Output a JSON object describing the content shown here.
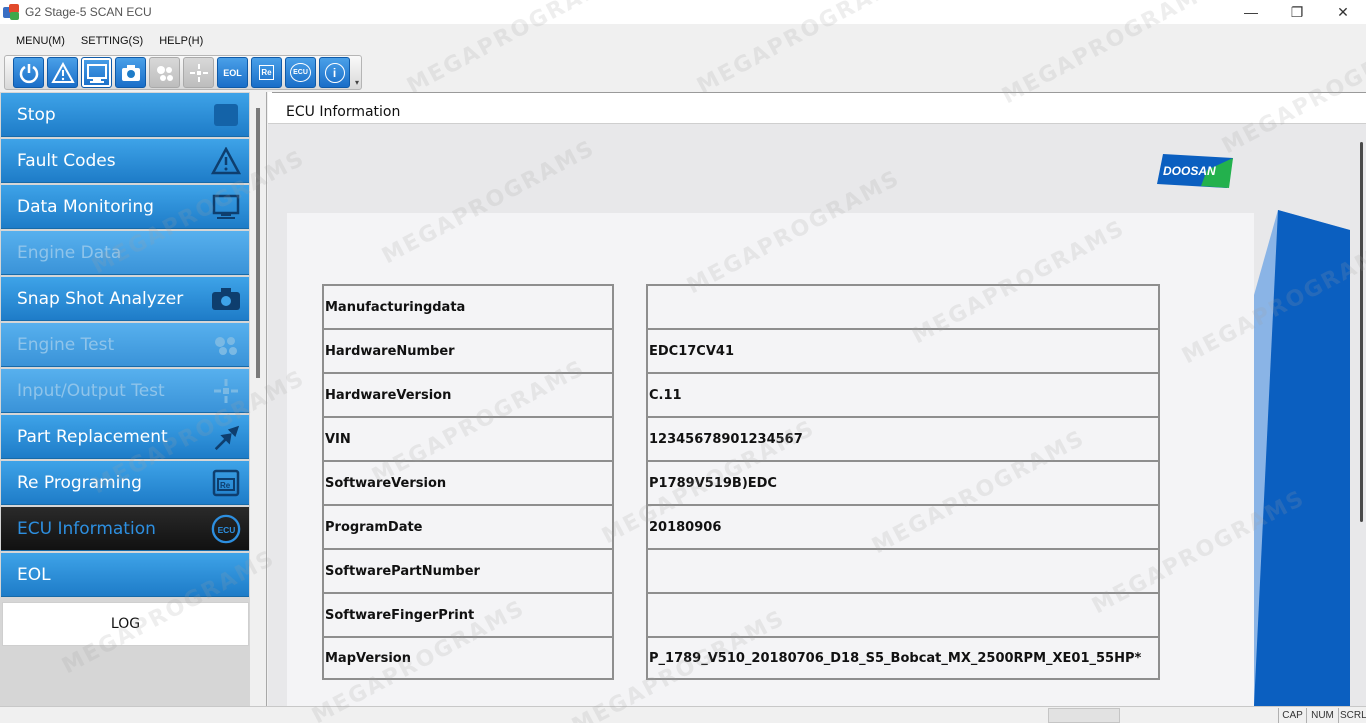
{
  "window": {
    "title": "G2 Stage-5 SCAN ECU",
    "controls": {
      "minimize": "—",
      "maximize": "❐",
      "close": "✕"
    }
  },
  "menu": [
    "MENU(M)",
    "SETTING(S)",
    "HELP(H)"
  ],
  "toolbar": {
    "buttons": [
      {
        "icon": "power-icon",
        "state": "enabled"
      },
      {
        "icon": "warning-icon",
        "state": "enabled"
      },
      {
        "icon": "monitor-icon",
        "state": "active"
      },
      {
        "icon": "camera-icon",
        "state": "enabled"
      },
      {
        "icon": "engine-icon",
        "state": "disabled"
      },
      {
        "icon": "io-icon",
        "state": "disabled"
      },
      {
        "icon": "eol-icon",
        "state": "enabled",
        "text": "EOL"
      },
      {
        "icon": "reprogram-icon",
        "state": "enabled",
        "text": "Re"
      },
      {
        "icon": "ecu-icon",
        "state": "enabled",
        "text": "ECU"
      },
      {
        "icon": "info-icon",
        "state": "enabled",
        "text": "i"
      }
    ]
  },
  "sidebar": {
    "items": [
      {
        "label": "Stop",
        "state": "enabled",
        "icon": "stop-icon"
      },
      {
        "label": "Fault Codes",
        "state": "enabled",
        "icon": "warning-icon"
      },
      {
        "label": "Data Monitoring",
        "state": "enabled",
        "icon": "monitor-icon"
      },
      {
        "label": "Engine Data",
        "state": "disabled",
        "icon": ""
      },
      {
        "label": "Snap Shot Analyzer",
        "state": "enabled",
        "icon": "camera-icon"
      },
      {
        "label": "Engine Test",
        "state": "disabled",
        "icon": "engine-icon"
      },
      {
        "label": "Input/Output Test",
        "state": "disabled",
        "icon": "io-icon"
      },
      {
        "label": "Part Replacement",
        "state": "enabled",
        "icon": "swap-icon"
      },
      {
        "label": "Re Programing",
        "state": "enabled",
        "icon": "reprogram-icon"
      },
      {
        "label": "ECU Information",
        "state": "active",
        "icon": "ecu-icon"
      },
      {
        "label": "EOL",
        "state": "enabled",
        "icon": ""
      }
    ],
    "log_label": "LOG"
  },
  "main": {
    "title": "ECU Information",
    "logo_text": "DOOSAN",
    "rows": [
      {
        "key": "Manufacturingdata",
        "value": ""
      },
      {
        "key": "HardwareNumber",
        "value": "EDC17CV41"
      },
      {
        "key": "HardwareVersion",
        "value": "C.11"
      },
      {
        "key": "VIN",
        "value": "12345678901234567"
      },
      {
        "key": "SoftwareVersion",
        "value": "P1789V519B)EDC"
      },
      {
        "key": "ProgramDate",
        "value": "20180906"
      },
      {
        "key": "SoftwarePartNumber",
        "value": ""
      },
      {
        "key": "SoftwareFingerPrint",
        "value": ""
      },
      {
        "key": "MapVersion",
        "value": "P_1789_V510_20180706_D18_S5_Bobcat_MX_2500RPM_XE01_55HP*"
      }
    ]
  },
  "statusbar": {
    "cap": "CAP",
    "num": "NUM",
    "scrl": "SCRL"
  },
  "watermark": "MEGAPROGRAMS",
  "colors": {
    "accent": "#1e7cc8",
    "active_bg": "#111111",
    "brand_blue": "#0b5fc0"
  }
}
